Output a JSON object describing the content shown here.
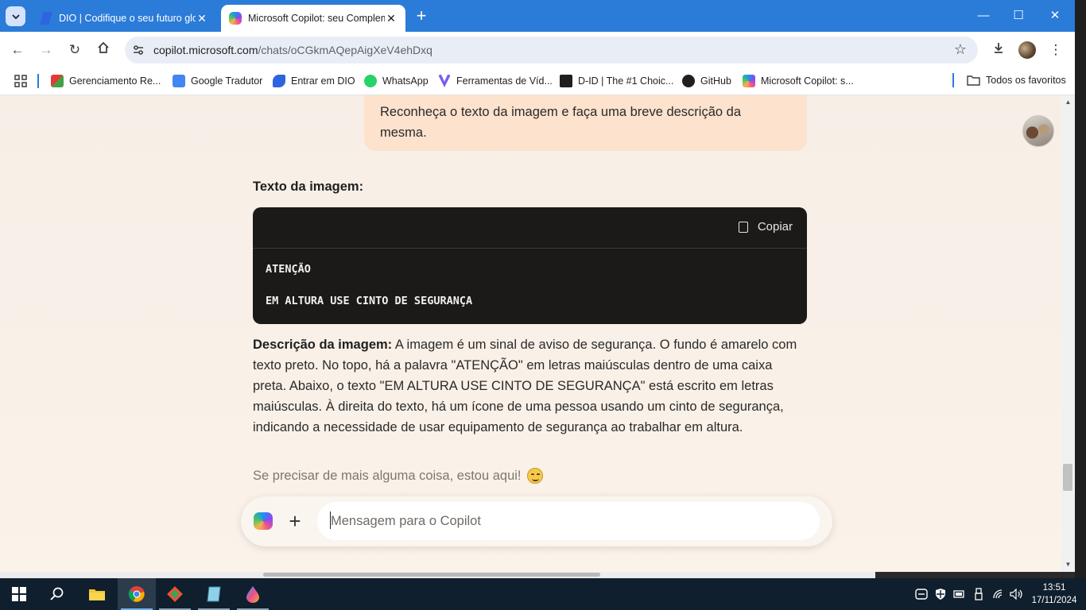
{
  "browser": {
    "tabs": [
      {
        "title": "DIO | Codifique o seu futuro glo",
        "active": false,
        "favicon": "dio-icon"
      },
      {
        "title": "Microsoft Copilot: seu Complem",
        "active": true,
        "favicon": "copilot-icon"
      }
    ],
    "address": {
      "host": "copilot.microsoft.com",
      "path": "/chats/oCGkmAQepAigXeV4ehDxq"
    },
    "bookmarks": [
      {
        "label": "Gerenciamento Re...",
        "icon": "colorful-grid-icon"
      },
      {
        "label": "Google Tradutor",
        "icon": "google-translate-icon"
      },
      {
        "label": "Entrar em DIO",
        "icon": "dio-icon"
      },
      {
        "label": "WhatsApp",
        "icon": "whatsapp-icon"
      },
      {
        "label": "Ferramentas de Víd...",
        "icon": "video-tools-icon"
      },
      {
        "label": "D-ID | The #1 Choic...",
        "icon": "did-icon"
      },
      {
        "label": "GitHub",
        "icon": "github-icon"
      },
      {
        "label": "Microsoft Copilot: s...",
        "icon": "copilot-icon"
      }
    ],
    "all_bookmarks": "Todos os favoritos"
  },
  "chat": {
    "user_message": "Reconheça o texto da imagem e faça uma breve descrição da mesma.",
    "heading": "Texto da imagem:",
    "code": {
      "copy_label": "Copiar",
      "lines": [
        "ATENÇÃO",
        "EM ALTURA USE CINTO DE SEGURANÇA"
      ]
    },
    "description_label": "Descrição da imagem:",
    "description_text": " A imagem é um sinal de aviso de segurança. O fundo é amarelo com texto preto. No topo, há a palavra \"ATENÇÃO\" em letras maiúsculas dentro de uma caixa preta. Abaixo, o texto \"EM ALTURA USE CINTO DE SEGURANÇA\" está escrito em letras maiúsculas. À direita do texto, há um ícone de uma pessoa usando um cinto de segurança, indicando a necessidade de usar equipamento de segurança ao trabalhar em altura.",
    "followup": "Se precisar de mais alguma coisa, estou aqui!",
    "input_placeholder": "Mensagem para o Copilot"
  },
  "taskbar": {
    "time": "13:51",
    "date": "17/11/2024"
  }
}
